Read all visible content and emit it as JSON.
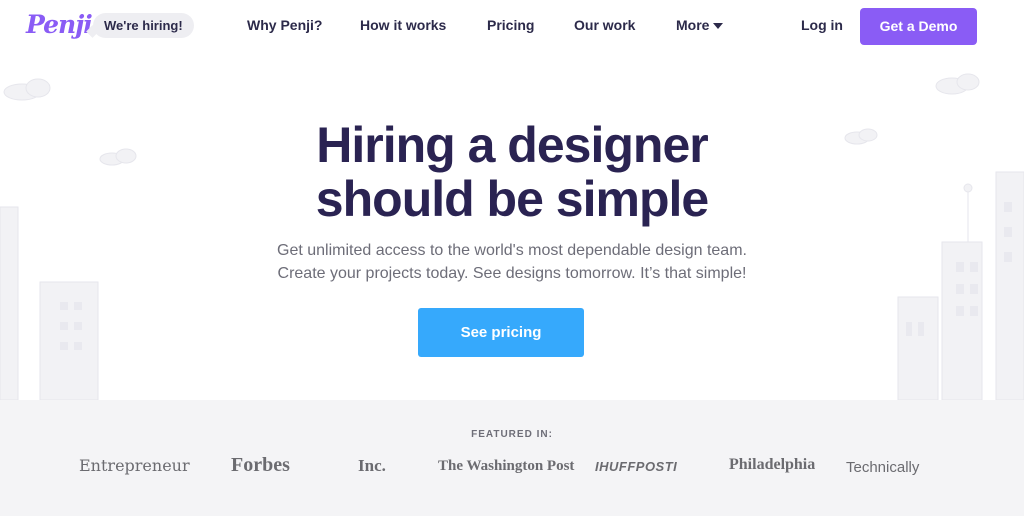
{
  "nav": {
    "logo": "Penji",
    "hiring_badge": "We're hiring!",
    "links": [
      {
        "label": "Why Penji?"
      },
      {
        "label": "How it works"
      },
      {
        "label": "Pricing"
      },
      {
        "label": "Our work"
      },
      {
        "label": "More"
      }
    ],
    "login": "Log in",
    "demo": "Get a Demo"
  },
  "hero": {
    "headline_line1": "Hiring a designer",
    "headline_line2": "should be simple",
    "sub_line1": "Get unlimited access to the world's most dependable design team.",
    "sub_line2": "Create your projects today. See designs tomorrow. It’s that simple!",
    "cta": "See pricing"
  },
  "featured": {
    "label": "FEATURED IN:",
    "logos": [
      "Entrepreneur",
      "Forbes",
      "Inc.",
      "The Washington Post",
      "IHUFFPOSTI",
      "Philadelphia",
      "Technically"
    ]
  },
  "colors": {
    "brand_purple": "#8a5cf5",
    "cta_blue": "#36a9fc",
    "headline": "#2a2352",
    "featured_bg": "#f4f4f6"
  },
  "icons": {
    "more_caret": "caret-down-icon"
  }
}
